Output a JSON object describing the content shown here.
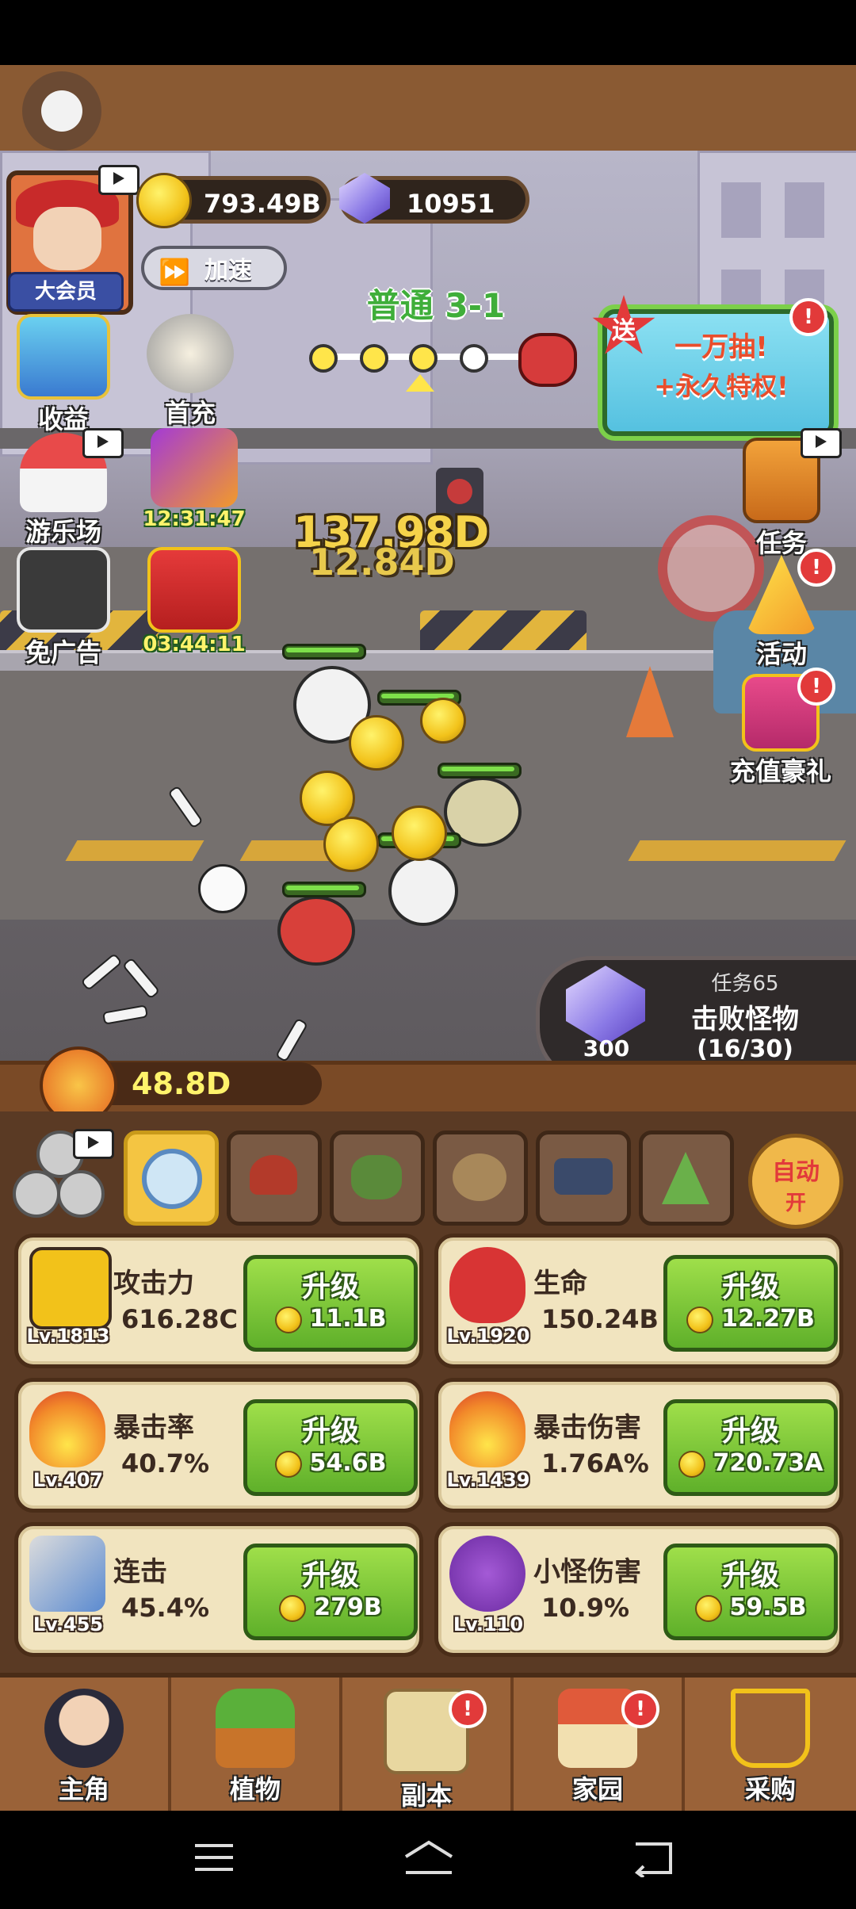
{
  "player": {
    "vip_label": "大会员"
  },
  "currency": {
    "gold": "793.49B",
    "gems": "10951"
  },
  "speed_button": {
    "label": "加速"
  },
  "stage": {
    "label": "普通 3-1"
  },
  "promo": {
    "badge": "送",
    "line1": "一万抽!",
    "line2": "+永久特权!"
  },
  "left_menu": [
    {
      "label": "收益",
      "icon": "income-icon"
    },
    {
      "label": "首充",
      "icon": "first-charge-icon"
    },
    {
      "label": "游乐场",
      "icon": "carousel-icon"
    },
    {
      "label": "12:31:47",
      "icon": "gift-box-icon"
    },
    {
      "label": "免广告",
      "icon": "no-ads-icon"
    },
    {
      "label": "03:44:11",
      "icon": "gift-red-icon"
    }
  ],
  "right_menu": [
    {
      "label": "任务",
      "icon": "task-book-icon"
    },
    {
      "label": "活动",
      "icon": "party-hat-icon"
    },
    {
      "label": "充值豪礼",
      "icon": "recharge-gift-icon"
    }
  ],
  "damage": {
    "big": "137.98D",
    "small": "12.84D"
  },
  "mission": {
    "id": "任务65",
    "title": "击败怪物",
    "progress": "(16/30)",
    "reward": "300"
  },
  "power": {
    "value": "48.8D"
  },
  "auto": {
    "label": "自动",
    "state": "开"
  },
  "stats": [
    {
      "name": "攻击力",
      "value": "616.28C",
      "level": "Lv.1813",
      "button": "升级",
      "cost": "11.1B",
      "icon": "fist-icon"
    },
    {
      "name": "生命",
      "value": "150.24B",
      "level": "Lv.1920",
      "button": "升级",
      "cost": "12.27B",
      "icon": "heart-icon"
    },
    {
      "name": "暴击率",
      "value": "40.7%",
      "level": "Lv.407",
      "button": "升级",
      "cost": "54.6B",
      "icon": "flame-icon"
    },
    {
      "name": "暴击伤害",
      "value": "1.76A%",
      "level": "Lv.1439",
      "button": "升级",
      "cost": "720.73A",
      "icon": "flame-percent-icon"
    },
    {
      "name": "连击",
      "value": "45.4%",
      "level": "Lv.455",
      "button": "升级",
      "cost": "279B",
      "icon": "arrows-icon"
    },
    {
      "name": "小怪伤害",
      "value": "10.9%",
      "level": "Lv.110",
      "button": "升级",
      "cost": "59.5B",
      "icon": "monster-icon"
    }
  ],
  "bottom_nav": [
    {
      "label": "主角",
      "icon": "hero-icon"
    },
    {
      "label": "植物",
      "icon": "plant-icon"
    },
    {
      "label": "副本",
      "icon": "map-icon"
    },
    {
      "label": "家园",
      "icon": "home-icon"
    },
    {
      "label": "采购",
      "icon": "cart-icon"
    }
  ],
  "colors": {
    "panel": "#5a3a24",
    "upgrade_green": "#5fb02a",
    "card_bg": "#f1e4bf",
    "gold": "#f2c21a"
  }
}
